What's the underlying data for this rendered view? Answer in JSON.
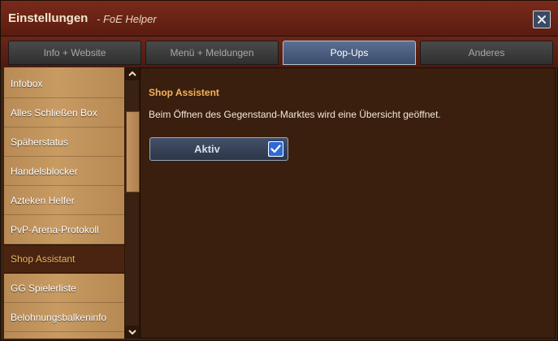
{
  "window": {
    "title": "Einstellungen",
    "subtitle": "- FoE Helper"
  },
  "tabs": [
    {
      "label": "Info + Website",
      "active": false
    },
    {
      "label": "Menü + Meldungen",
      "active": false
    },
    {
      "label": "Pop-Ups",
      "active": true
    },
    {
      "label": "Anderes",
      "active": false
    }
  ],
  "sidebar": {
    "items": [
      {
        "label": "Infobox"
      },
      {
        "label": "Alles Schließen Box"
      },
      {
        "label": "Späherstatus"
      },
      {
        "label": "Handelsblocker"
      },
      {
        "label": "Azteken Helfer"
      },
      {
        "label": "PvP-Arena-Protokoll"
      },
      {
        "label": "Shop Assistant",
        "active": true
      },
      {
        "label": "GG Spielerliste"
      },
      {
        "label": "Belohnungsbalkeninfo"
      }
    ]
  },
  "content": {
    "title": "Shop Assistent",
    "description": "Beim Öffnen des Gegenstand-Marktes wird eine Übersicht geöffnet.",
    "toggle": {
      "label": "Aktiv",
      "checked": true
    }
  },
  "colors": {
    "accent_title": "#f4b35a",
    "active_tab": "#4a5d80",
    "checkbox": "#2f69d6"
  }
}
